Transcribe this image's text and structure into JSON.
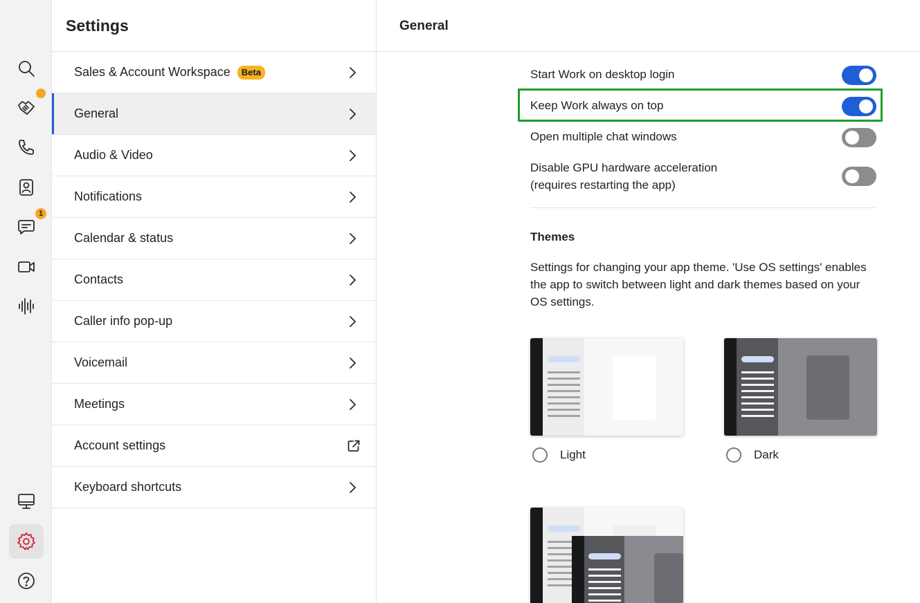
{
  "rail": {
    "items": [
      {
        "icon": "search-icon"
      },
      {
        "icon": "handshake-icon",
        "badge": "dot"
      },
      {
        "icon": "phone-icon"
      },
      {
        "icon": "contacts-book-icon"
      },
      {
        "icon": "chat-icon",
        "badge_count": "1"
      },
      {
        "icon": "video-icon"
      },
      {
        "icon": "voice-waveform-icon"
      }
    ],
    "bottom": [
      {
        "icon": "monitor-icon"
      },
      {
        "icon": "gear-icon",
        "active": true
      },
      {
        "icon": "help-icon"
      }
    ],
    "chat_badge": "1"
  },
  "nav": {
    "title": "Settings",
    "items": [
      {
        "label": "Sales & Account Workspace",
        "badge": "Beta",
        "trailing": "chevron"
      },
      {
        "label": "General",
        "active": true,
        "trailing": "chevron"
      },
      {
        "label": "Audio & Video",
        "trailing": "chevron"
      },
      {
        "label": "Notifications",
        "trailing": "chevron"
      },
      {
        "label": "Calendar & status",
        "trailing": "chevron"
      },
      {
        "label": "Contacts",
        "trailing": "chevron"
      },
      {
        "label": "Caller info pop-up",
        "trailing": "chevron"
      },
      {
        "label": "Voicemail",
        "trailing": "chevron"
      },
      {
        "label": "Meetings",
        "trailing": "chevron"
      },
      {
        "label": "Account settings",
        "trailing": "external-link"
      },
      {
        "label": "Keyboard shortcuts",
        "trailing": "chevron"
      }
    ]
  },
  "main": {
    "title": "General",
    "options": [
      {
        "line1": "Start Work on desktop login",
        "line2": "",
        "on": true
      },
      {
        "line1": "Keep Work always on top",
        "line2": "",
        "on": true
      },
      {
        "line1": "Open multiple chat windows",
        "line2": "",
        "on": false
      },
      {
        "line1": "Disable GPU hardware acceleration",
        "line2": "(requires restarting the app)",
        "on": false
      }
    ],
    "themes": {
      "title": "Themes",
      "description": "Settings for changing your app theme. 'Use OS settings' enables the app to switch between light and dark themes based on your OS settings.",
      "options": [
        {
          "label": "Light",
          "selected": false
        },
        {
          "label": "Dark",
          "selected": false
        }
      ]
    }
  },
  "colors": {
    "accent": "#1f5fd6",
    "highlight_border": "#1f9d2c",
    "badge": "#f5a623",
    "active_gear": "#d1243b"
  }
}
